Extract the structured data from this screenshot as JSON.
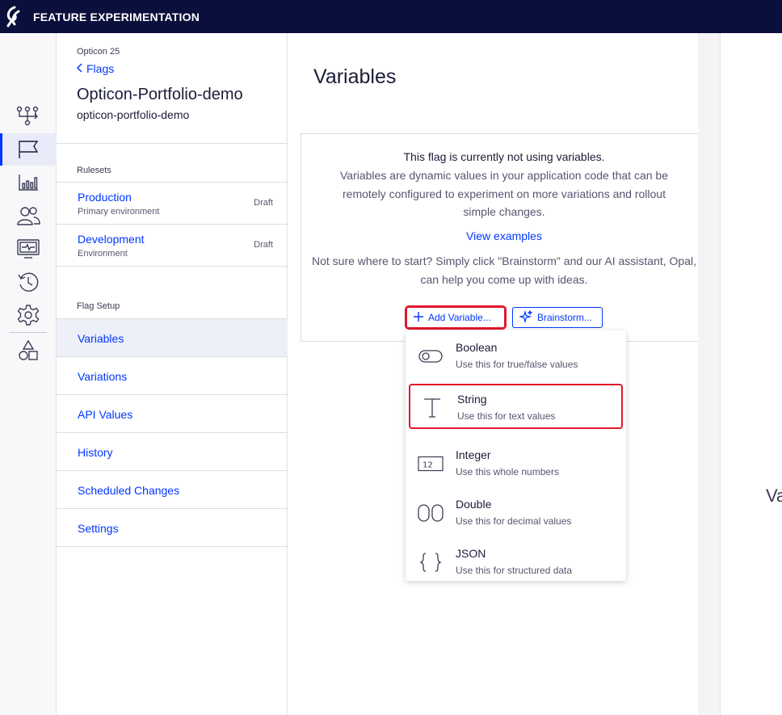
{
  "header": {
    "app_title": "FEATURE EXPERIMENTATION"
  },
  "rail": {
    "items": [
      {
        "icon": "flow-icon"
      },
      {
        "icon": "flag-icon",
        "active": true
      },
      {
        "icon": "reports-icon"
      },
      {
        "icon": "audiences-icon"
      },
      {
        "icon": "monitor-icon"
      },
      {
        "icon": "history-icon"
      },
      {
        "icon": "settings-icon"
      },
      {
        "icon": "shapes-icon"
      }
    ]
  },
  "sidebar": {
    "project": "Opticon 25",
    "back_label": "Flags",
    "flag_name": "Opticon-Portfolio-demo",
    "flag_key": "opticon-portfolio-demo",
    "rulesets_heading": "Rulesets",
    "rulesets": [
      {
        "name": "Production",
        "sub": "Primary environment",
        "status": "Draft"
      },
      {
        "name": "Development",
        "sub": "Environment",
        "status": "Draft"
      }
    ],
    "setup_heading": "Flag Setup",
    "nav": [
      {
        "label": "Variables",
        "active": true
      },
      {
        "label": "Variations"
      },
      {
        "label": "API Values"
      },
      {
        "label": "History"
      },
      {
        "label": "Scheduled Changes"
      },
      {
        "label": "Settings"
      }
    ]
  },
  "main": {
    "title": "Variables",
    "empty": {
      "heading": "This flag is currently not using variables.",
      "body": "Variables are dynamic values in your application code that can be remotely configured to experiment on more variations and rollout simple changes.",
      "link": "View examples",
      "hint": "Not sure where to start? Simply click \"Brainstorm\" and our AI assistant, Opal, can help you come up with ideas.",
      "add_button": "Add Variable...",
      "brainstorm_button": "Brainstorm..."
    }
  },
  "menu": {
    "items": [
      {
        "label": "Boolean",
        "desc": "Use this for true/false values",
        "icon": "toggle-icon"
      },
      {
        "label": "String",
        "desc": "Use this for text values",
        "icon": "text-icon",
        "highlighted": true
      },
      {
        "label": "Integer",
        "desc": "Use this whole numbers",
        "icon": "integer-icon"
      },
      {
        "label": "Double",
        "desc": "Use this for decimal values",
        "icon": "double-icon"
      },
      {
        "label": "JSON",
        "desc": "Use this for structured data",
        "icon": "json-icon"
      }
    ]
  },
  "right_pane": {
    "partial_text": "Va"
  },
  "colors": {
    "brand_navy": "#0b0f3c",
    "link_blue": "#0037ff",
    "highlight_red": "#e0172b"
  }
}
